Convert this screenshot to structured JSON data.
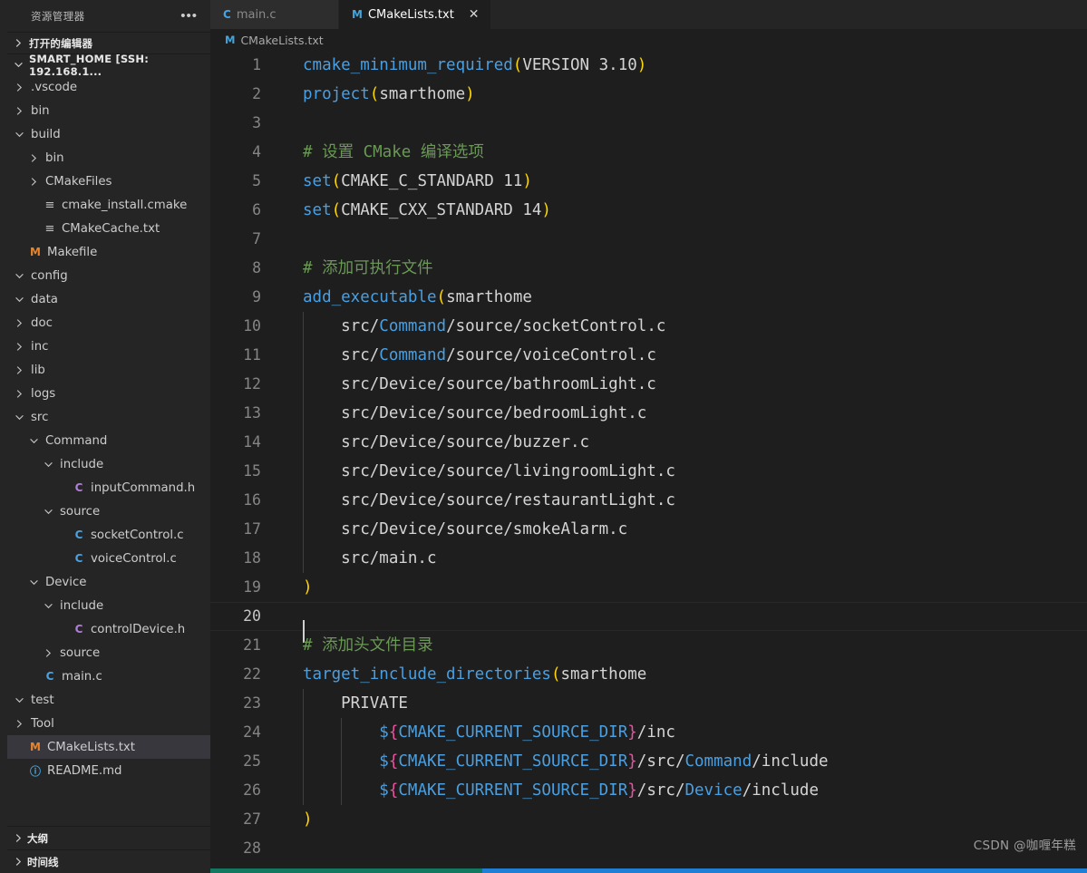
{
  "sidebar": {
    "title": "资源管理器",
    "more_label": "•••",
    "open_editors_label": "打开的编辑器",
    "project_label": "SMART_HOME [SSH: 192.168.1...",
    "outline_label": "大纲",
    "timeline_label": "时间线",
    "tree": [
      {
        "label": ".vscode",
        "indent": 1,
        "twisty": "collapsed",
        "icon": ""
      },
      {
        "label": "bin",
        "indent": 1,
        "twisty": "collapsed",
        "icon": ""
      },
      {
        "label": "build",
        "indent": 1,
        "twisty": "expanded",
        "icon": ""
      },
      {
        "label": "bin",
        "indent": 2,
        "twisty": "collapsed",
        "icon": ""
      },
      {
        "label": "CMakeFiles",
        "indent": 2,
        "twisty": "collapsed",
        "icon": ""
      },
      {
        "label": "cmake_install.cmake",
        "indent": 2,
        "twisty": "none",
        "icon": "file-lines-icon"
      },
      {
        "label": "CMakeCache.txt",
        "indent": 2,
        "twisty": "none",
        "icon": "file-lines-icon"
      },
      {
        "label": "Makefile",
        "indent": 1,
        "twisty": "none",
        "icon": "makefile-icon"
      },
      {
        "label": "config",
        "indent": 1,
        "twisty": "expanded",
        "icon": ""
      },
      {
        "label": "data",
        "indent": 1,
        "twisty": "expanded",
        "icon": ""
      },
      {
        "label": "doc",
        "indent": 1,
        "twisty": "collapsed",
        "icon": ""
      },
      {
        "label": "inc",
        "indent": 1,
        "twisty": "collapsed",
        "icon": ""
      },
      {
        "label": "lib",
        "indent": 1,
        "twisty": "collapsed",
        "icon": ""
      },
      {
        "label": "logs",
        "indent": 1,
        "twisty": "collapsed",
        "icon": ""
      },
      {
        "label": "src",
        "indent": 1,
        "twisty": "expanded",
        "icon": ""
      },
      {
        "label": "Command",
        "indent": 2,
        "twisty": "expanded",
        "icon": ""
      },
      {
        "label": "include",
        "indent": 3,
        "twisty": "expanded",
        "icon": ""
      },
      {
        "label": "inputCommand.h",
        "indent": 4,
        "twisty": "none",
        "icon": "header-file-icon"
      },
      {
        "label": "source",
        "indent": 3,
        "twisty": "expanded",
        "icon": ""
      },
      {
        "label": "socketControl.c",
        "indent": 4,
        "twisty": "none",
        "icon": "c-file-icon"
      },
      {
        "label": "voiceControl.c",
        "indent": 4,
        "twisty": "none",
        "icon": "c-file-icon"
      },
      {
        "label": "Device",
        "indent": 2,
        "twisty": "expanded",
        "icon": ""
      },
      {
        "label": "include",
        "indent": 3,
        "twisty": "expanded",
        "icon": ""
      },
      {
        "label": "controlDevice.h",
        "indent": 4,
        "twisty": "none",
        "icon": "header-file-icon"
      },
      {
        "label": "source",
        "indent": 3,
        "twisty": "collapsed",
        "icon": ""
      },
      {
        "label": "main.c",
        "indent": 2,
        "twisty": "none",
        "icon": "c-file-icon"
      },
      {
        "label": "test",
        "indent": 1,
        "twisty": "expanded",
        "icon": ""
      },
      {
        "label": "Tool",
        "indent": 1,
        "twisty": "collapsed",
        "icon": ""
      },
      {
        "label": "CMakeLists.txt",
        "indent": 1,
        "twisty": "none",
        "icon": "makefile-icon",
        "selected": true
      },
      {
        "label": "README.md",
        "indent": 1,
        "twisty": "none",
        "icon": "readme-icon"
      }
    ]
  },
  "tabs": [
    {
      "label": "main.c",
      "icon": "c-file-icon",
      "active": false,
      "closable": false
    },
    {
      "label": "CMakeLists.txt",
      "icon": "makefile-icon",
      "active": true,
      "closable": true,
      "close_label": "✕"
    }
  ],
  "breadcrumb": {
    "icon": "makefile-icon",
    "label": "CMakeLists.txt"
  },
  "editor": {
    "watermark": "CSDN @咖喱年糕",
    "active_line": 20,
    "lines": [
      {
        "n": 1,
        "tokens": [
          {
            "t": "cmake_minimum_required",
            "c": "fn"
          },
          {
            "t": "(",
            "c": "paren-y"
          },
          {
            "t": "VERSION 3.10",
            "c": "arg"
          },
          {
            "t": ")",
            "c": "paren-y"
          }
        ]
      },
      {
        "n": 2,
        "tokens": [
          {
            "t": "project",
            "c": "fn"
          },
          {
            "t": "(",
            "c": "paren-y"
          },
          {
            "t": "smarthome",
            "c": "arg"
          },
          {
            "t": ")",
            "c": "paren-y"
          }
        ]
      },
      {
        "n": 3,
        "tokens": []
      },
      {
        "n": 4,
        "tokens": [
          {
            "t": "# 设置 CMake 编译选项",
            "c": "comment"
          }
        ]
      },
      {
        "n": 5,
        "tokens": [
          {
            "t": "set",
            "c": "fn"
          },
          {
            "t": "(",
            "c": "paren-y"
          },
          {
            "t": "CMAKE_C_STANDARD 11",
            "c": "arg"
          },
          {
            "t": ")",
            "c": "paren-y"
          }
        ]
      },
      {
        "n": 6,
        "tokens": [
          {
            "t": "set",
            "c": "fn"
          },
          {
            "t": "(",
            "c": "paren-y"
          },
          {
            "t": "CMAKE_CXX_STANDARD 14",
            "c": "arg"
          },
          {
            "t": ")",
            "c": "paren-y"
          }
        ]
      },
      {
        "n": 7,
        "tokens": []
      },
      {
        "n": 8,
        "tokens": [
          {
            "t": "# 添加可执行文件",
            "c": "comment"
          }
        ]
      },
      {
        "n": 9,
        "tokens": [
          {
            "t": "add_executable",
            "c": "fn"
          },
          {
            "t": "(",
            "c": "paren-y"
          },
          {
            "t": "smarthome",
            "c": "arg"
          }
        ]
      },
      {
        "n": 10,
        "indent_guides": 1,
        "tokens": [
          {
            "t": "    src/",
            "c": "arg"
          },
          {
            "t": "Command",
            "c": "dir"
          },
          {
            "t": "/source/socketControl.c",
            "c": "arg"
          }
        ]
      },
      {
        "n": 11,
        "indent_guides": 1,
        "tokens": [
          {
            "t": "    src/",
            "c": "arg"
          },
          {
            "t": "Command",
            "c": "dir"
          },
          {
            "t": "/source/voiceControl.c",
            "c": "arg"
          }
        ]
      },
      {
        "n": 12,
        "indent_guides": 1,
        "tokens": [
          {
            "t": "    src/Device/source/bathroomLight.c",
            "c": "arg"
          }
        ]
      },
      {
        "n": 13,
        "indent_guides": 1,
        "tokens": [
          {
            "t": "    src/Device/source/bedroomLight.c",
            "c": "arg"
          }
        ]
      },
      {
        "n": 14,
        "indent_guides": 1,
        "tokens": [
          {
            "t": "    src/Device/source/buzzer.c",
            "c": "arg"
          }
        ]
      },
      {
        "n": 15,
        "indent_guides": 1,
        "tokens": [
          {
            "t": "    src/Device/source/livingroomLight.c",
            "c": "arg"
          }
        ]
      },
      {
        "n": 16,
        "indent_guides": 1,
        "tokens": [
          {
            "t": "    src/Device/source/restaurantLight.c",
            "c": "arg"
          }
        ]
      },
      {
        "n": 17,
        "indent_guides": 1,
        "tokens": [
          {
            "t": "    src/Device/source/smokeAlarm.c",
            "c": "arg"
          }
        ]
      },
      {
        "n": 18,
        "indent_guides": 1,
        "tokens": [
          {
            "t": "    src/main.c",
            "c": "arg"
          }
        ]
      },
      {
        "n": 19,
        "tokens": [
          {
            "t": ")",
            "c": "paren-y"
          }
        ]
      },
      {
        "n": 20,
        "tokens": []
      },
      {
        "n": 21,
        "tokens": [
          {
            "t": "# 添加头文件目录",
            "c": "comment"
          }
        ]
      },
      {
        "n": 22,
        "tokens": [
          {
            "t": "target_include_directories",
            "c": "fn"
          },
          {
            "t": "(",
            "c": "paren-y"
          },
          {
            "t": "smarthome",
            "c": "arg"
          }
        ]
      },
      {
        "n": 23,
        "indent_guides": 1,
        "tokens": [
          {
            "t": "    PRIVATE",
            "c": "arg"
          }
        ]
      },
      {
        "n": 24,
        "indent_guides": 2,
        "tokens": [
          {
            "t": "        $",
            "c": "var"
          },
          {
            "t": "{",
            "c": "brace"
          },
          {
            "t": "CMAKE_CURRENT_SOURCE_DIR",
            "c": "var"
          },
          {
            "t": "}",
            "c": "brace"
          },
          {
            "t": "/inc",
            "c": "arg"
          }
        ]
      },
      {
        "n": 25,
        "indent_guides": 2,
        "tokens": [
          {
            "t": "        $",
            "c": "var"
          },
          {
            "t": "{",
            "c": "brace"
          },
          {
            "t": "CMAKE_CURRENT_SOURCE_DIR",
            "c": "var"
          },
          {
            "t": "}",
            "c": "brace"
          },
          {
            "t": "/src/",
            "c": "arg"
          },
          {
            "t": "Command",
            "c": "dir"
          },
          {
            "t": "/include",
            "c": "arg"
          }
        ]
      },
      {
        "n": 26,
        "indent_guides": 2,
        "tokens": [
          {
            "t": "        $",
            "c": "var"
          },
          {
            "t": "{",
            "c": "brace"
          },
          {
            "t": "CMAKE_CURRENT_SOURCE_DIR",
            "c": "var"
          },
          {
            "t": "}",
            "c": "brace"
          },
          {
            "t": "/src/",
            "c": "arg"
          },
          {
            "t": "Device",
            "c": "dir"
          },
          {
            "t": "/include",
            "c": "arg"
          }
        ]
      },
      {
        "n": 27,
        "tokens": [
          {
            "t": ")",
            "c": "paren-y"
          }
        ]
      },
      {
        "n": 28,
        "tokens": []
      }
    ]
  },
  "colors": {
    "editor_bg": "#1e1e1e",
    "sidebar_bg": "#252526",
    "selection_bg": "#37373d",
    "accent_blue": "#4a9fe0",
    "comment_green": "#6a9955",
    "paren_yellow": "#ffd700",
    "brace_pink": "#e754a0",
    "status_blue": "#1e7fd4",
    "status_teal": "#12785f"
  }
}
